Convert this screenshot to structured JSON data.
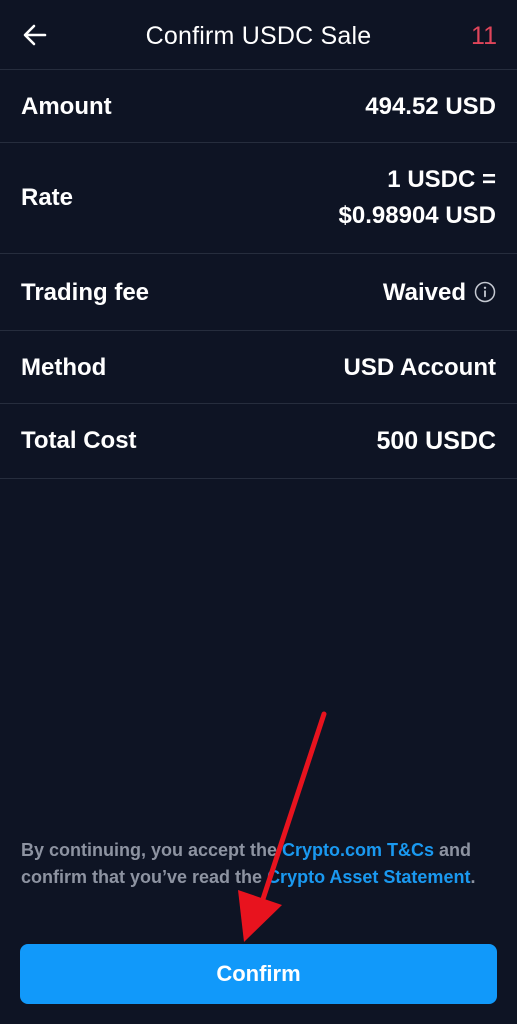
{
  "header": {
    "title": "Confirm USDC Sale",
    "countdown": "11",
    "back_icon": "arrow-left-icon"
  },
  "details": {
    "amount": {
      "label": "Amount",
      "value": "494.52 USD"
    },
    "rate": {
      "label": "Rate",
      "value_line1": "1 USDC =",
      "value_line2": "$0.98904 USD"
    },
    "trading_fee": {
      "label": "Trading fee",
      "value": "Waived",
      "icon": "info-icon"
    },
    "method": {
      "label": "Method",
      "value": "USD Account"
    },
    "total_cost": {
      "label": "Total Cost",
      "value": "500 USDC"
    }
  },
  "disclaimer": {
    "text_1": "By continuing, you accept the ",
    "link_1": "Crypto.com T&Cs",
    "text_2": " and confirm that you’ve read the ",
    "link_2": "Crypto Asset Statement",
    "text_3": "."
  },
  "confirm_button": {
    "label": "Confirm"
  },
  "colors": {
    "background": "#0e1424",
    "divider": "#262d3d",
    "accent": "#1199fa",
    "link": "#1a99f0",
    "countdown": "#e0455a",
    "muted_text": "#8d93a1",
    "annotation_arrow": "#e8131e"
  }
}
